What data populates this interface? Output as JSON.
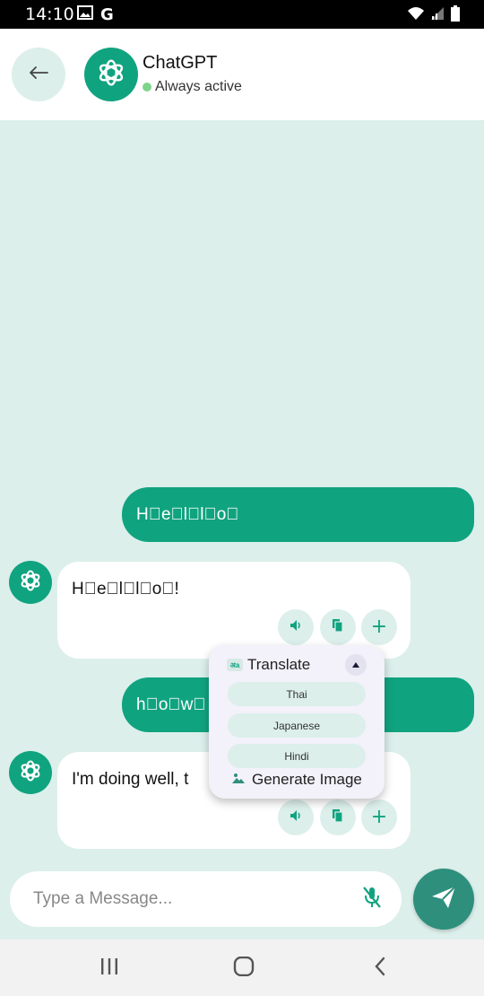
{
  "status_bar": {
    "time": "14:10",
    "left_icons": [
      "image-icon",
      "google-icon"
    ],
    "right_icons": [
      "wifi-icon",
      "signal-icon",
      "battery-icon"
    ]
  },
  "header": {
    "title": "ChatGPT",
    "status": "Always active",
    "status_color": "#7ed48a",
    "avatar_icon": "openai-logo-icon",
    "back_icon": "arrow-left-icon"
  },
  "messages": [
    {
      "role": "user",
      "text": "H\u0000e\u0000l\u0000l\u0000o\u0000"
    },
    {
      "role": "assistant",
      "text": "H\u0000e\u0000l\u0000l\u0000o\u0000!"
    },
    {
      "role": "user",
      "text": "h\u0000o\u0000w\u0000"
    },
    {
      "role": "assistant",
      "text": "I'm doing well, t"
    }
  ],
  "message_actions": [
    "speaker-icon",
    "copy-icon",
    "plus-icon"
  ],
  "popup": {
    "translate_label": "Translate",
    "translate_icon": "translate-icon",
    "translate_icon_text": "अa",
    "collapse_icon": "triangle-up-icon",
    "languages": [
      "Thai",
      "Japanese",
      "Hindi"
    ],
    "generate_label": "Generate Image",
    "generate_icon": "image-icon"
  },
  "input": {
    "placeholder": "Type a Message...",
    "value": "",
    "mic_icon": "mic-off-icon",
    "send_icon": "send-icon"
  },
  "nav_bar": {
    "icons": [
      "recent-apps-icon",
      "home-icon",
      "back-chevron-icon"
    ]
  },
  "colors": {
    "accent": "#10a37f",
    "background": "#dcefeb",
    "send_button": "#2e8f7d"
  }
}
